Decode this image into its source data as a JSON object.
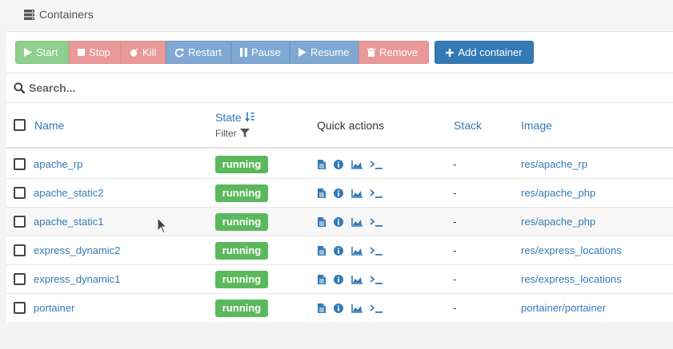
{
  "header": {
    "title": "Containers",
    "icon": "server-icon"
  },
  "toolbar": {
    "start": "Start",
    "stop": "Stop",
    "kill": "Kill",
    "restart": "Restart",
    "pause": "Pause",
    "resume": "Resume",
    "remove": "Remove",
    "add_container": "Add container"
  },
  "search": {
    "placeholder": "Search..."
  },
  "table": {
    "columns": {
      "name": "Name",
      "state": "State",
      "state_filter": "Filter",
      "quick_actions": "Quick actions",
      "stack": "Stack",
      "image": "Image"
    },
    "rows": [
      {
        "name": "apache_rp",
        "state": "running",
        "stack": "-",
        "image": "res/apache_rp"
      },
      {
        "name": "apache_static2",
        "state": "running",
        "stack": "-",
        "image": "res/apache_php"
      },
      {
        "name": "apache_static1",
        "state": "running",
        "stack": "-",
        "image": "res/apache_php"
      },
      {
        "name": "express_dynamic2",
        "state": "running",
        "stack": "-",
        "image": "res/express_locations"
      },
      {
        "name": "express_dynamic1",
        "state": "running",
        "stack": "-",
        "image": "res/express_locations"
      },
      {
        "name": "portainer",
        "state": "running",
        "stack": "-",
        "image": "portainer/portainer"
      }
    ],
    "quick_action_icons": [
      "logs-icon",
      "inspect-icon",
      "stats-icon",
      "console-icon"
    ]
  },
  "colors": {
    "accent": "#337ab7",
    "running": "#5cb85c",
    "success_button": "#8fd08f",
    "danger_button": "#e99a98",
    "info_button": "#7fa8d3"
  }
}
